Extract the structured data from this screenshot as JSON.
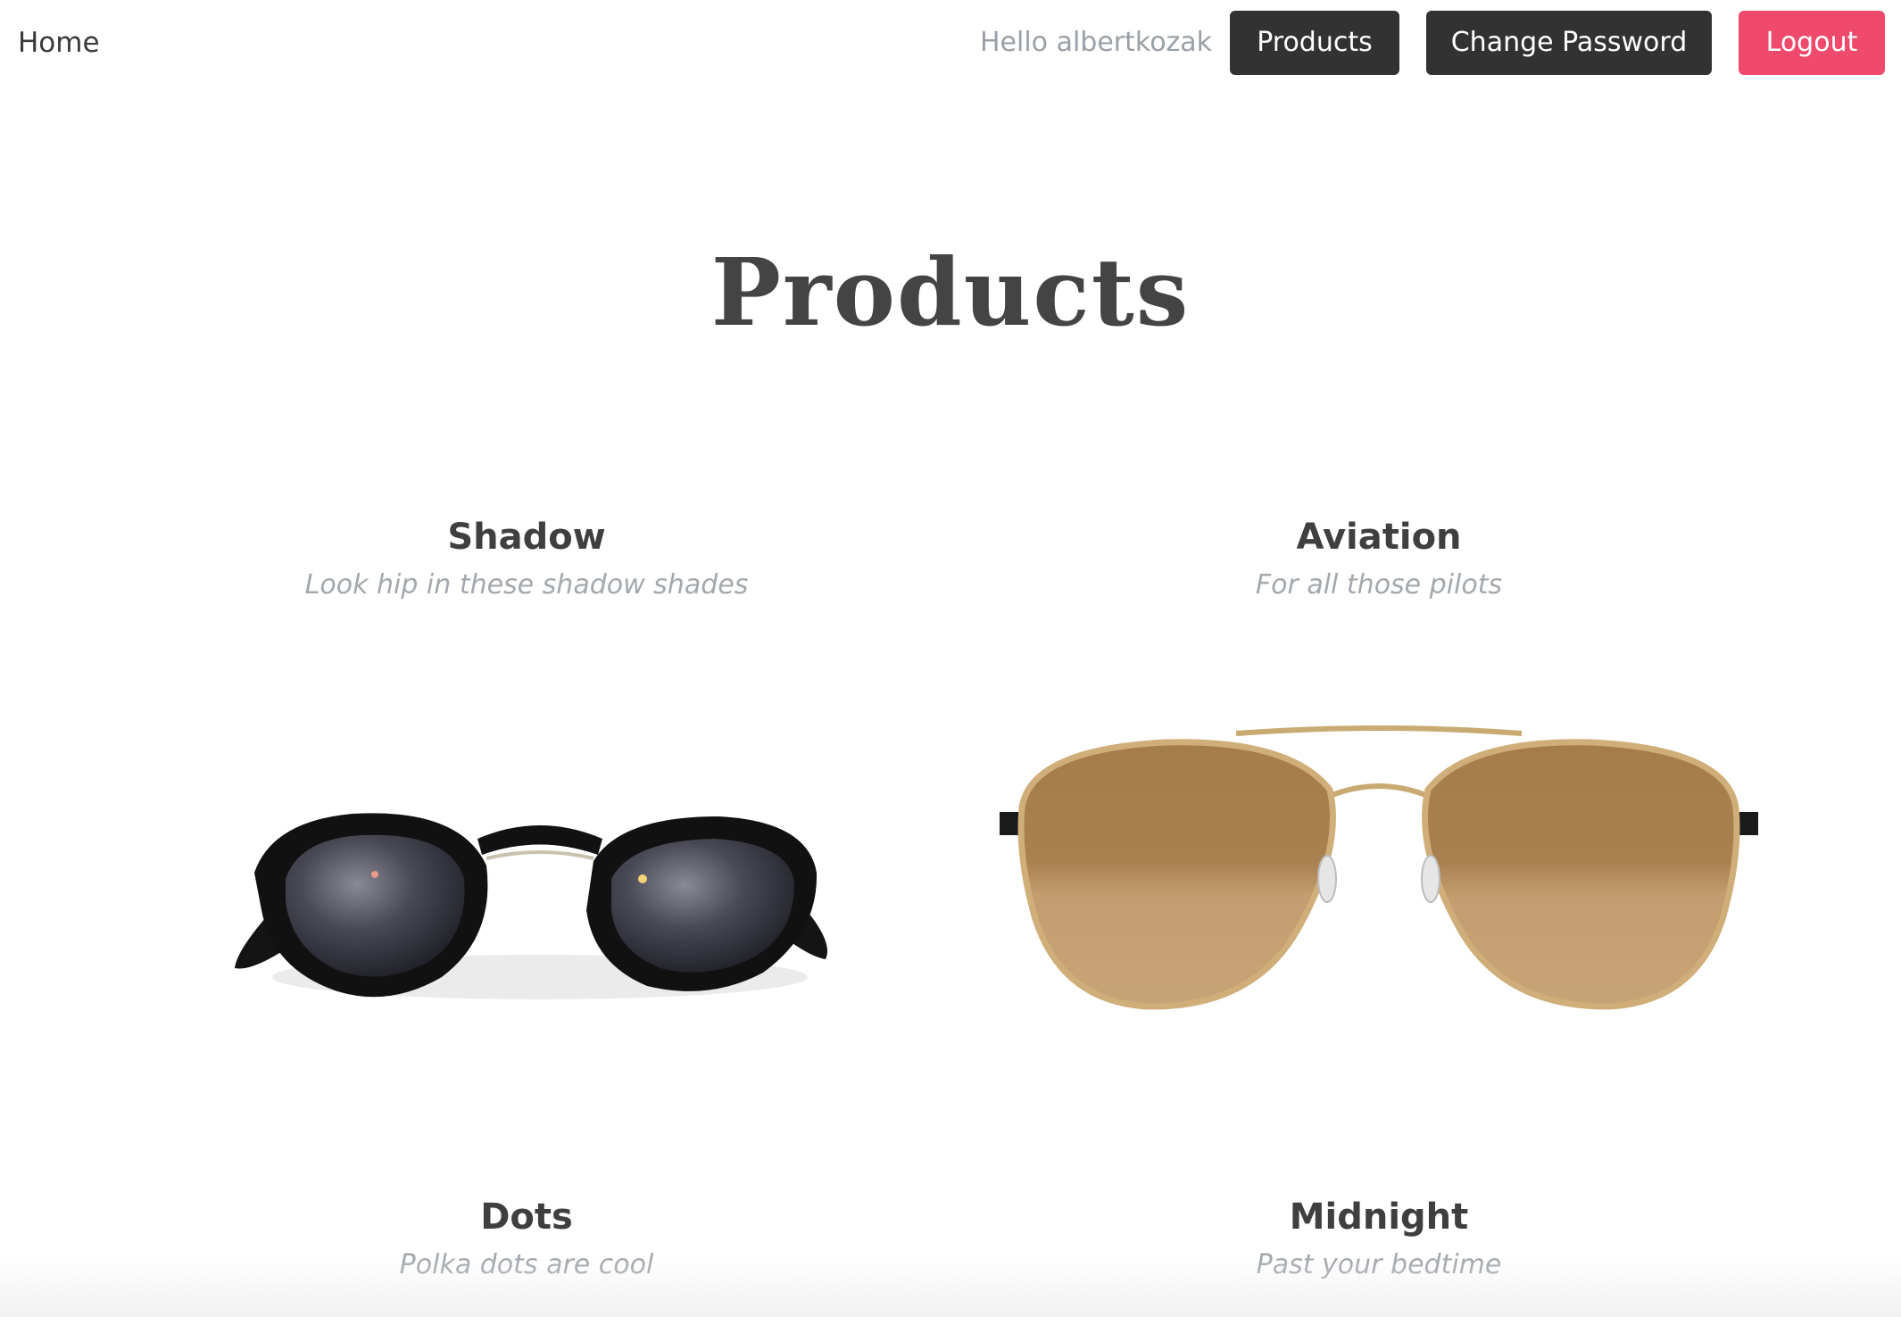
{
  "nav": {
    "home_label": "Home",
    "greeting": "Hello albertkozak",
    "products_label": "Products",
    "change_password_label": "Change Password",
    "logout_label": "Logout"
  },
  "colors": {
    "dark_button": "#323232",
    "logout_button": "#ef4a6c",
    "heading": "#444444",
    "muted_text": "#a3a8ad"
  },
  "page": {
    "title": "Products"
  },
  "products": [
    {
      "name": "Shadow",
      "description": "Look hip in these shadow shades",
      "image": "black-round-sunglasses"
    },
    {
      "name": "Aviation",
      "description": "For all those pilots",
      "image": "gold-aviator-sunglasses"
    },
    {
      "name": "Dots",
      "description": "Polka dots are cool"
    },
    {
      "name": "Midnight",
      "description": "Past your bedtime"
    }
  ]
}
